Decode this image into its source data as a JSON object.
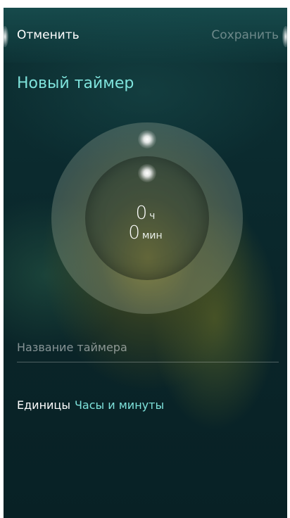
{
  "header": {
    "cancel_label": "Отменить",
    "save_label": "Сохранить"
  },
  "title": "Новый таймер",
  "dial": {
    "hours_value": "0",
    "hours_unit": "ч",
    "minutes_value": "0",
    "minutes_unit": "мин"
  },
  "name_field": {
    "value": "",
    "placeholder": "Название таймера"
  },
  "units": {
    "label": "Единицы",
    "value": "Часы и минуты"
  },
  "colors": {
    "accent": "#7fe3dc",
    "background": "#0b2b2f"
  }
}
